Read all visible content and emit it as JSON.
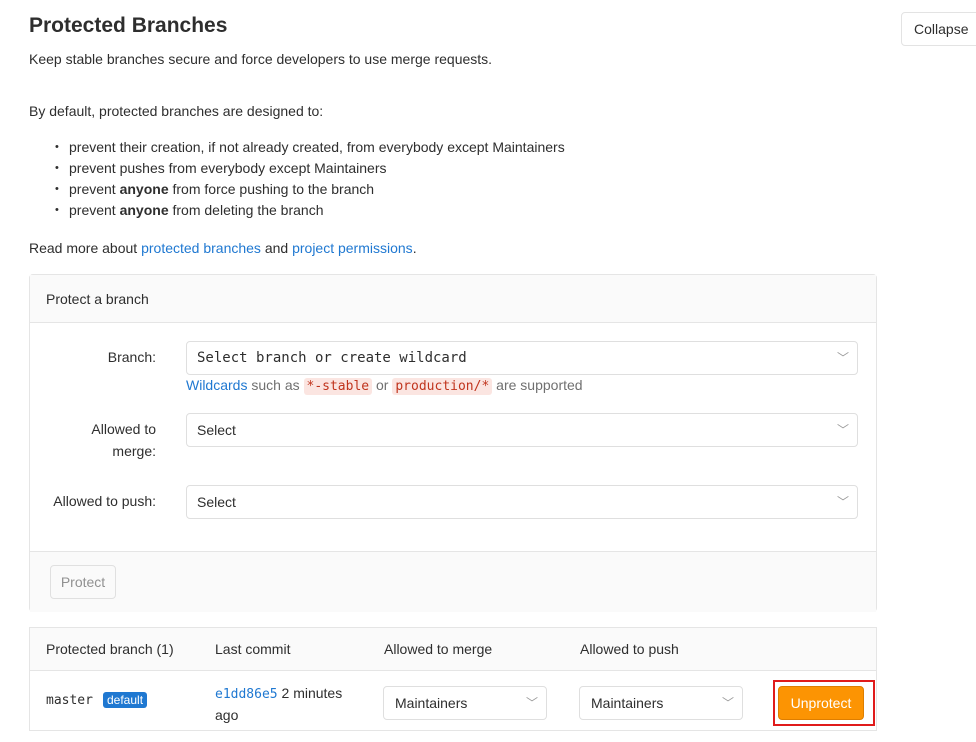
{
  "header": {
    "title": "Protected Branches",
    "lead": "Keep stable branches secure and force developers to use merge requests.",
    "collapse_label": "Collapse"
  },
  "description": {
    "intro": "By default, protected branches are designed to:",
    "rules": [
      {
        "pre": "prevent their creation, if not already created, from everybody except Maintainers",
        "bold": "",
        "post": ""
      },
      {
        "pre": "prevent pushes from everybody except Maintainers",
        "bold": "",
        "post": ""
      },
      {
        "pre": "prevent ",
        "bold": "anyone",
        "post": " from force pushing to the branch"
      },
      {
        "pre": "prevent ",
        "bold": "anyone",
        "post": " from deleting the branch"
      }
    ],
    "readmore_pre": "Read more about ",
    "link_protected": "protected branches",
    "readmore_mid": " and ",
    "link_permissions": "project permissions",
    "readmore_post": "."
  },
  "form": {
    "card_title": "Protect a branch",
    "branch_label": "Branch:",
    "branch_placeholder": "Select branch or create wildcard",
    "hint_link": "Wildcards",
    "hint_pre": " such as ",
    "hint_code1": "*-stable",
    "hint_or": " or ",
    "hint_code2": "production/*",
    "hint_post": " are supported",
    "merge_label_1": "Allowed to",
    "merge_label_2": "merge:",
    "merge_value": "Select",
    "push_label": "Allowed to push:",
    "push_value": "Select",
    "protect_label": "Protect"
  },
  "table": {
    "headers": [
      "Protected branch (1)",
      "Last commit",
      "Allowed to merge",
      "Allowed to push"
    ],
    "rows": [
      {
        "branch": "master",
        "badge": "default",
        "commit_sha": "e1dd86e5",
        "commit_time_1": " 2 minutes",
        "commit_time_2": "ago",
        "merge": "Maintainers",
        "push": "Maintainers",
        "action": "Unprotect"
      }
    ]
  },
  "icons": {
    "dropdown": "chevron-down-icon"
  },
  "colors": {
    "link": "#1f78d1",
    "unprotect": "#fc9403",
    "highlight": "#e01b1b"
  }
}
